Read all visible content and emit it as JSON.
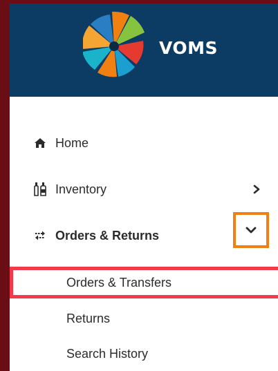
{
  "app": {
    "name": "VOMS"
  },
  "nav": {
    "home": {
      "label": "Home",
      "icon": "home-icon"
    },
    "inventory": {
      "label": "Inventory",
      "icon": "bottles-icon",
      "chevron": "chevron-right-icon"
    },
    "orders_returns": {
      "label": "Orders & Returns",
      "icon": "transfer-arrows-icon",
      "chevron": "chevron-down-icon"
    }
  },
  "submenu": {
    "items": [
      {
        "label": "Orders & Transfers",
        "highlighted": true
      },
      {
        "label": "Returns"
      },
      {
        "label": "Search History"
      }
    ]
  },
  "colors": {
    "header_bg": "#0c3c63",
    "frame_border": "#6b0d14",
    "highlight_red": "#f23a4a",
    "highlight_orange": "#f08012"
  }
}
